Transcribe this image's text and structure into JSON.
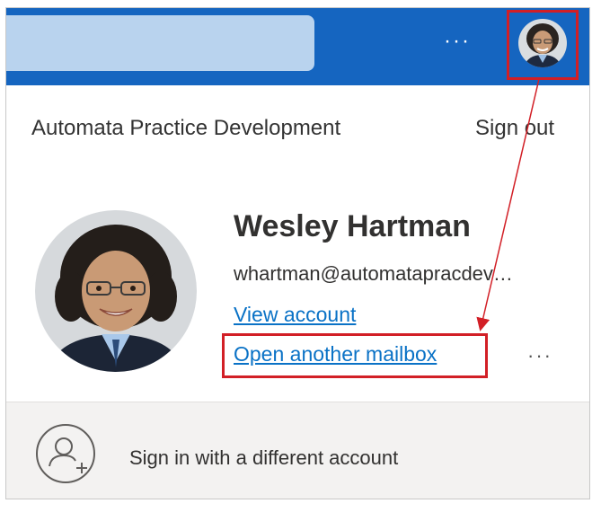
{
  "header": {
    "more_label": "···",
    "avatar_icon": "user-photo-icon"
  },
  "account": {
    "tenant": "Automata Practice Development",
    "sign_out": "Sign out",
    "name": "Wesley Hartman",
    "email": "whartman@automatapracdev…",
    "view_account": "View account",
    "open_mailbox": "Open another mailbox",
    "more_label": "···"
  },
  "footer": {
    "add_account_label": "Sign in with a different account",
    "add_account_icon": "person-add-icon"
  },
  "colors": {
    "header_bg": "#1565c0",
    "search_bg": "#b9d3ee",
    "link": "#0a72c6",
    "highlight": "#d21f26",
    "footer_bg": "#f3f2f1"
  }
}
